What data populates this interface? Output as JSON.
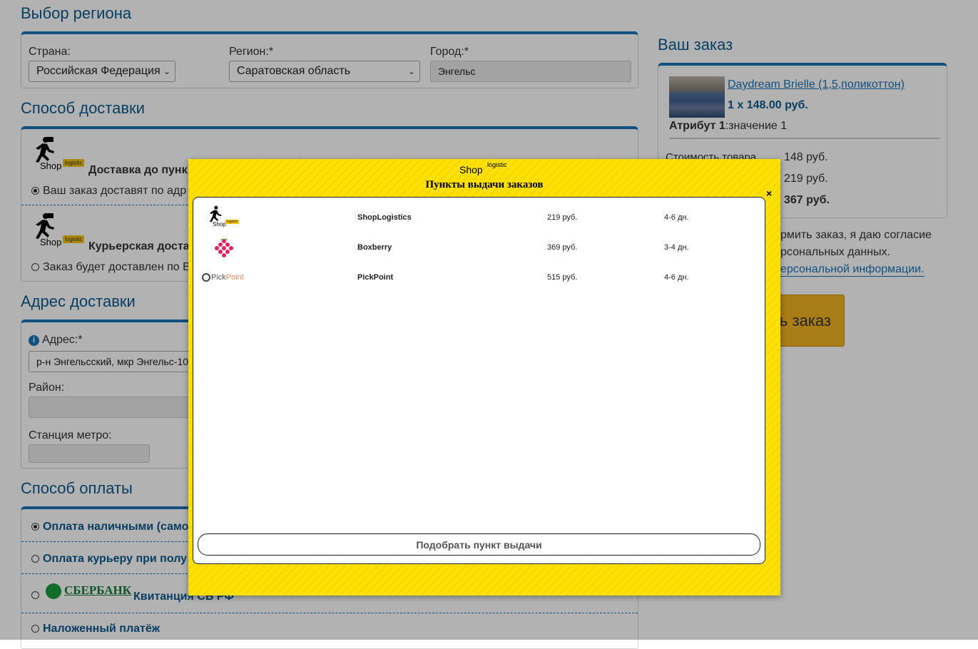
{
  "region": {
    "title": "Выбор региона",
    "country_label": "Страна:",
    "country_value": "Российская Федерация",
    "region_label": "Регион:*",
    "region_value": "Саратовская область",
    "city_label": "Город:*",
    "city_value": "Энгельс"
  },
  "delivery": {
    "title": "Способ доставки",
    "logo_word": "Shop",
    "logo_badge": "logistic",
    "option1_title": "Доставка до пунк",
    "option1_desc": "Ваш заказ доставят по адр",
    "option2_title": "Курьерская доста",
    "option2_desc": "Заказ будет доставлен по В"
  },
  "address": {
    "title": "Адрес доставки",
    "address_label": "Адрес:*",
    "address_value": "р-н Энгельсский, мкр Энгельс-10",
    "district_label": "Район:",
    "metro_label": "Станция метро:"
  },
  "payment": {
    "title": "Способ оплаты",
    "option1": "Оплата наличными (само",
    "option2": "Оплата курьеру при полу",
    "sber_logo": "СБЕРБАНК",
    "option3": "Квитанция СБ РФ",
    "option4": "Наложенный платёж"
  },
  "order": {
    "title": "Ваш заказ",
    "product_name": "Daydream Brielle (1,5,поликоттон)",
    "product_qty_price": "1 x 148.00 руб.",
    "attr_name": "Атрибут 1",
    "attr_value": ":значение 1",
    "cost_label": "Стоимость товара",
    "cost_value": "148 руб.",
    "delivery_value": "219 руб.",
    "total_value": "367 руб.",
    "consent_line1": "рмить заказ, я даю согласие",
    "consent_line2": "рсональных данных.",
    "consent_link": "ерсональной информации.",
    "submit_label": "ь заказ"
  },
  "modal": {
    "logo_word": "Shop",
    "logo_sup": "logistic",
    "title": "Пункты выдачи заказов",
    "close": "×",
    "rows": [
      {
        "logo": "shoplogistics-logo",
        "name": "ShopLogistics",
        "price": "219 руб.",
        "days": "4-6 дн.",
        "logo_word": "Shop",
        "logo_badge": "logistic"
      },
      {
        "logo": "boxberry-logo",
        "name": "Boxberry",
        "price": "369 руб.",
        "days": "3-4 дн."
      },
      {
        "logo": "pickpoint-logo",
        "name": "PickPoint",
        "price": "515 руб.",
        "days": "4-6 дн.",
        "logo_text_a": "Pick",
        "logo_text_b": "Point"
      }
    ],
    "pick_button": "Подобрать пункт выдачи"
  },
  "colors": {
    "accent": "#1a73b8",
    "heading": "#0b5a8c",
    "modal_bg": "#ffe100",
    "order_button": "#f2b31f"
  }
}
